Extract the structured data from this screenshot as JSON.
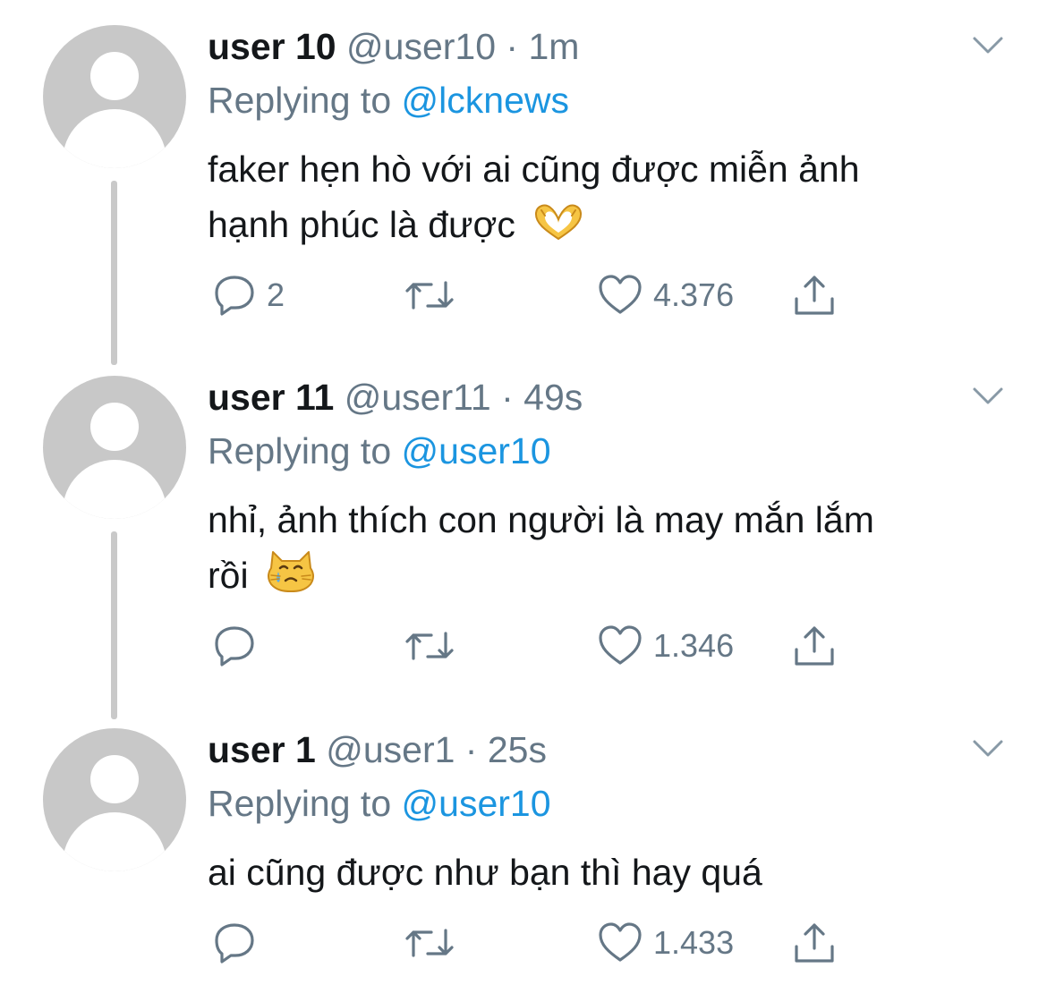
{
  "tweets": [
    {
      "name": "user 10",
      "handle": "@user10",
      "time": "1m",
      "replying_prefix": "Replying to",
      "replying_to": "@lcknews",
      "text_line1": "faker hẹn hò với ai cũng được miễn ảnh",
      "text_line2": "hạnh phúc là được",
      "emoji": "heart-hands-emoji",
      "reply_count": "2",
      "retweet_count": "",
      "like_count": "4.376"
    },
    {
      "name": "user 11",
      "handle": "@user11",
      "time": "49s",
      "replying_prefix": "Replying to",
      "replying_to": "@user10",
      "text_line1": "nhỉ, ảnh thích con người là may mắn lắm",
      "text_line2": "rồi",
      "emoji": "crying-cat-emoji",
      "reply_count": "",
      "retweet_count": "",
      "like_count": "1.346"
    },
    {
      "name": "user 1",
      "handle": "@user1",
      "time": "25s",
      "replying_prefix": "Replying to",
      "replying_to": "@user10",
      "text_line1": "ai cũng được như bạn thì hay quá",
      "text_line2": "",
      "emoji": "",
      "reply_count": "",
      "retweet_count": "",
      "like_count": "1.433"
    }
  ],
  "separator": " · ",
  "icons": {
    "reply": "reply-icon",
    "retweet": "retweet-icon",
    "like": "heart-icon",
    "share": "share-icon",
    "more": "chevron-down-icon"
  },
  "colors": {
    "text": "#14171a",
    "secondary": "#657786",
    "link": "#1b95e0",
    "avatar_bg": "#c8c8c8",
    "thread_line": "#c9c9c9"
  }
}
